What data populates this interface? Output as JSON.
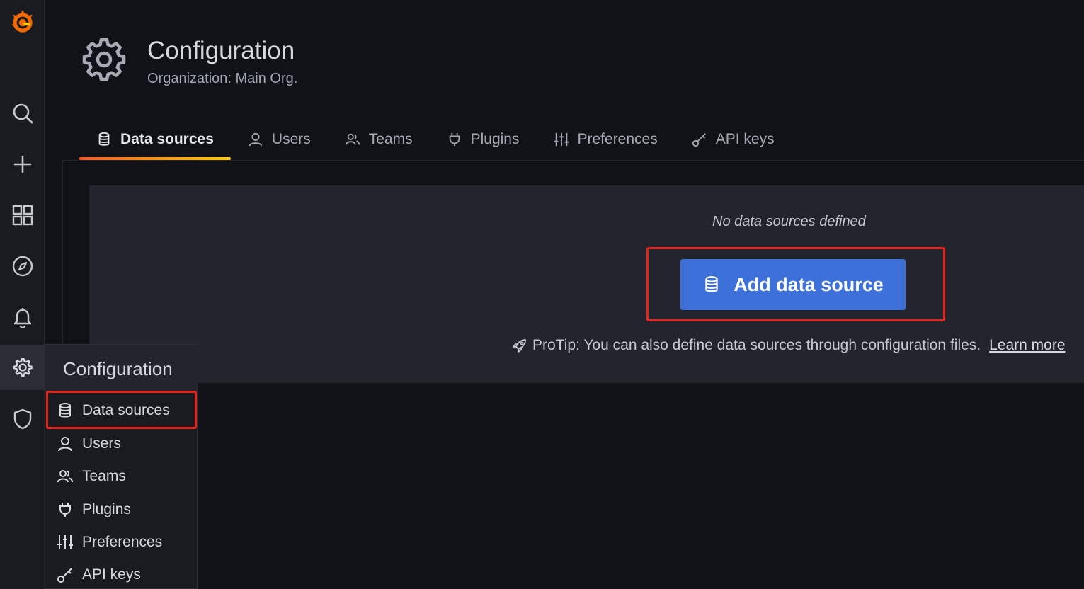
{
  "colors": {
    "accent_blue": "#3d71d9",
    "highlight_red": "#e8231d",
    "tab_gradient_start": "#f05a28",
    "tab_gradient_end": "#fbca0a"
  },
  "sidebar": {
    "items": [
      {
        "name": "grafana-logo",
        "icon": "grafana-logo"
      },
      {
        "name": "search",
        "icon": "search-icon"
      },
      {
        "name": "create",
        "icon": "plus-icon"
      },
      {
        "name": "dashboards",
        "icon": "apps-icon"
      },
      {
        "name": "explore",
        "icon": "compass-icon"
      },
      {
        "name": "alerting",
        "icon": "bell-icon"
      },
      {
        "name": "configuration",
        "icon": "gear-icon"
      },
      {
        "name": "server-admin",
        "icon": "shield-icon"
      }
    ]
  },
  "header": {
    "title": "Configuration",
    "subtitle": "Organization: Main Org.",
    "icon": "gear-icon"
  },
  "tabs": [
    {
      "label": "Data sources",
      "icon": "database-icon",
      "active": true
    },
    {
      "label": "Users",
      "icon": "user-icon",
      "active": false
    },
    {
      "label": "Teams",
      "icon": "users-icon",
      "active": false
    },
    {
      "label": "Plugins",
      "icon": "plug-icon",
      "active": false
    },
    {
      "label": "Preferences",
      "icon": "sliders-icon",
      "active": false
    },
    {
      "label": "API keys",
      "icon": "key-icon",
      "active": false
    }
  ],
  "empty_state": {
    "title": "No data sources defined",
    "button_label": "Add data source",
    "protip_text": "ProTip: You can also define data sources through configuration files.",
    "protip_link": "Learn more"
  },
  "flyout": {
    "title": "Configuration",
    "items": [
      {
        "label": "Data sources",
        "icon": "database-icon"
      },
      {
        "label": "Users",
        "icon": "user-icon"
      },
      {
        "label": "Teams",
        "icon": "users-icon"
      },
      {
        "label": "Plugins",
        "icon": "plug-icon"
      },
      {
        "label": "Preferences",
        "icon": "sliders-icon"
      },
      {
        "label": "API keys",
        "icon": "key-icon"
      }
    ]
  }
}
